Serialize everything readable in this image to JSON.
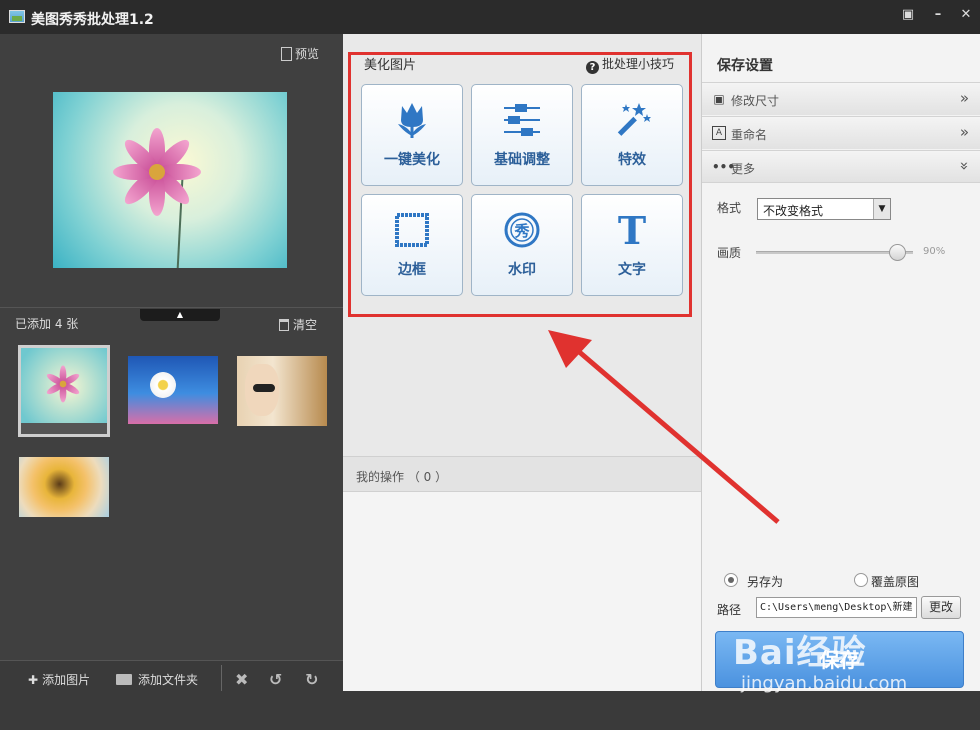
{
  "window": {
    "title": "美图秀秀批处理1.2"
  },
  "left": {
    "preview_label": "预览",
    "added_count": "已添加 4 张",
    "clear_label": "清空",
    "toolbar": {
      "add_image": "添加图片",
      "add_folder": "添加文件夹"
    }
  },
  "center": {
    "section_title": "美化图片",
    "tips_label": "批处理小技巧",
    "tools": [
      "一键美化",
      "基础调整",
      "特效",
      "边框",
      "水印",
      "文字"
    ],
    "ops_label": "我的操作 （ 0 ）"
  },
  "right": {
    "title": "保存设置",
    "accordion": [
      "修改尺寸",
      "重命名",
      "更多"
    ],
    "format_label": "格式",
    "format_value": "不改变格式",
    "quality_label": "画质",
    "quality_value": "90%",
    "quality_level": 0.9,
    "save_as_label": "另存为",
    "overwrite_label": "覆盖原图",
    "path_label": "路径",
    "path_value": "C:\\Users\\meng\\Desktop\\新建",
    "change_label": "更改",
    "save_label": "保存"
  },
  "watermark": {
    "brand": "Bai经验",
    "url": "jingyan.baidu.com"
  },
  "colors": {
    "annotation_red": "#e0322f",
    "button_blue": "#2c5f99",
    "save_blue": "#4b92df"
  }
}
